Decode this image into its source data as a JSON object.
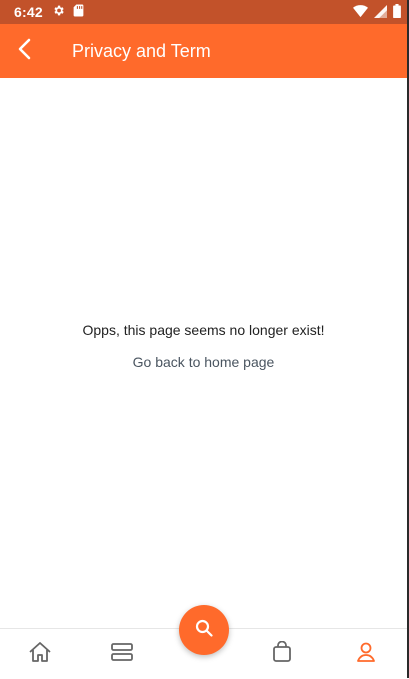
{
  "status_bar": {
    "time": "6:42",
    "left_icons": [
      "gear-icon",
      "sd-card-icon"
    ],
    "right_icons": [
      "wifi-icon",
      "signal-icon",
      "battery-icon"
    ]
  },
  "app_bar": {
    "title": "Privacy and Term",
    "back_icon": "back-arrow-icon"
  },
  "content": {
    "message": "Opps, this page seems no longer exist!",
    "home_link": "Go back to home page"
  },
  "bottom_nav": {
    "items": [
      {
        "icon": "home-icon"
      },
      {
        "icon": "categories-icon"
      },
      {
        "icon": "search-icon"
      },
      {
        "icon": "bag-icon"
      },
      {
        "icon": "profile-icon",
        "active": true
      }
    ]
  },
  "colors": {
    "accent": "#ff6a2b",
    "status_bar": "#c2522a",
    "nav_icon": "#666666"
  }
}
